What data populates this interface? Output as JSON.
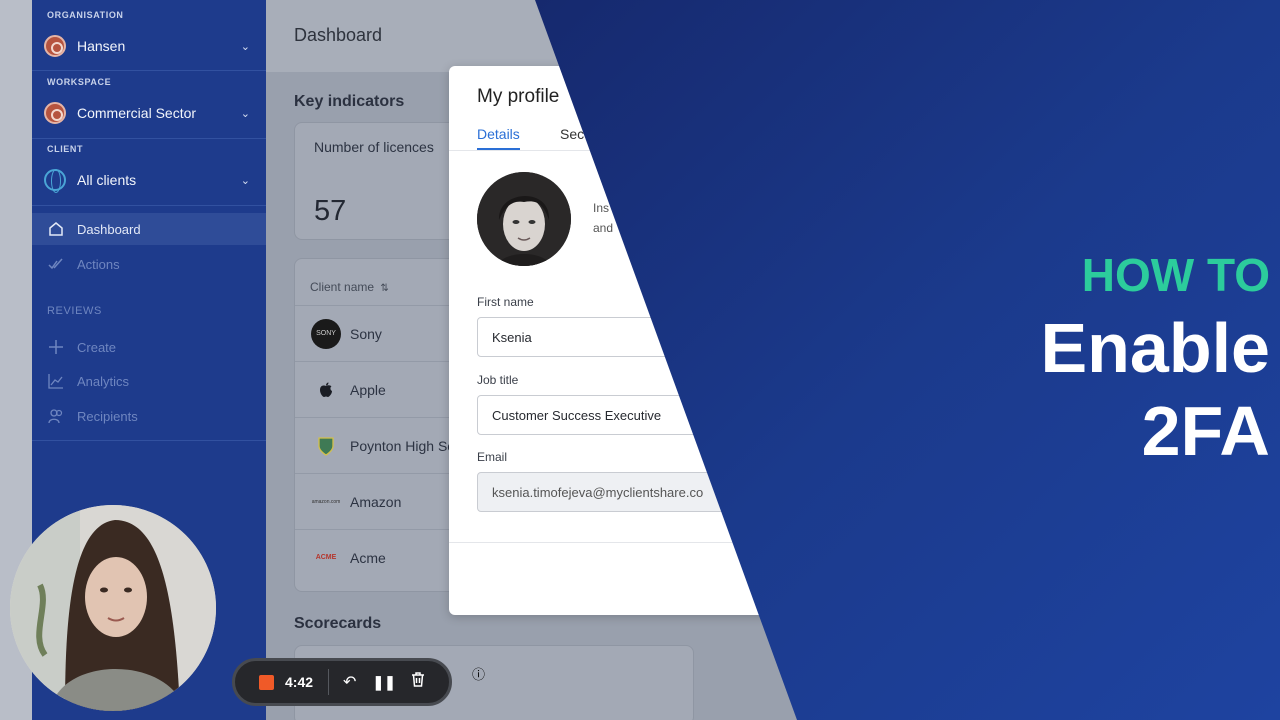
{
  "sidebar": {
    "organisation_label": "ORGANISATION",
    "organisation_value": "Hansen",
    "workspace_label": "WORKSPACE",
    "workspace_value": "Commercial Sector",
    "client_label": "CLIENT",
    "client_value": "All clients",
    "nav": [
      {
        "label": "Dashboard",
        "icon": "home-icon"
      },
      {
        "label": "Actions",
        "icon": "check-icon"
      }
    ],
    "reviews_label": "REVIEWS",
    "reviews": [
      {
        "label": "Create",
        "icon": "plus-icon"
      },
      {
        "label": "Analytics",
        "icon": "chart-icon"
      },
      {
        "label": "Recipients",
        "icon": "people-icon"
      }
    ]
  },
  "main": {
    "title": "Dashboard",
    "key_indicators": "Key indicators",
    "licences_label": "Number of licences",
    "licences_value": "57",
    "client_col": "Client name",
    "sort_icon": "sort-icon",
    "clients": [
      {
        "name": "Sony",
        "logo_text": "SONY"
      },
      {
        "name": "Apple",
        "logo_text": ""
      },
      {
        "name": "Poynton High Sc",
        "logo_text": ""
      },
      {
        "name": "Amazon",
        "logo_text": "amazon.com"
      },
      {
        "name": "Acme",
        "logo_text": "ACME"
      }
    ],
    "scorecards": "Scorecards"
  },
  "modal": {
    "title": "My profile",
    "tabs": [
      "Details",
      "Sec"
    ],
    "photo_text_1": "Ins",
    "photo_text_2": "and",
    "first_name_label": "First name",
    "first_name_value": "Ksenia",
    "job_title_label": "Job title",
    "job_title_value": "Customer Success Executive",
    "email_label": "Email",
    "email_value": "ksenia.timofejeva@myclientshare.co"
  },
  "headline": {
    "line1": "HOW TO",
    "line2": "Enable",
    "line3": "2FA"
  },
  "recorder": {
    "time": "4:42"
  },
  "colors": {
    "blue_panel": "#1a3a8a",
    "accent_green": "#2ccc9c",
    "recorder_stop": "#f05a28"
  }
}
